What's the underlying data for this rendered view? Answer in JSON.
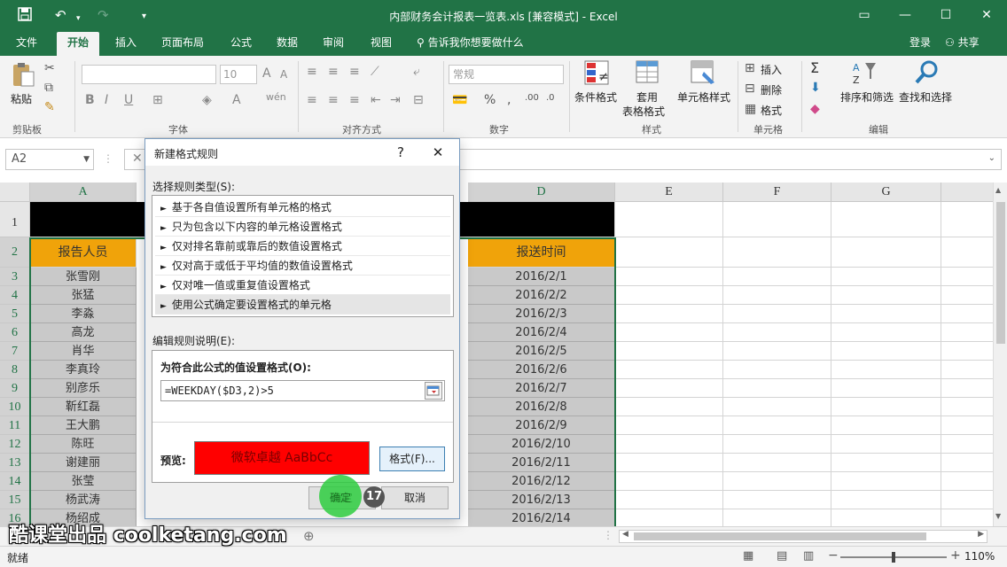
{
  "window": {
    "title": "内部财务会计报表一览表.xls  [兼容模式] - Excel",
    "buttons": [
      "restore-ribbon",
      "minimize",
      "maximize",
      "close"
    ]
  },
  "tabs": {
    "file": "文件",
    "home": "开始",
    "insert": "插入",
    "page_layout": "页面布局",
    "formulas": "公式",
    "data": "数据",
    "review": "审阅",
    "view": "视图",
    "tell_me": "告诉我你想要做什么",
    "login": "登录",
    "share": "共享"
  },
  "ribbon": {
    "clipboard": {
      "paste": "粘贴",
      "group": "剪贴板"
    },
    "font": {
      "size": "10",
      "group": "字体"
    },
    "alignment": {
      "group": "对齐方式"
    },
    "number": {
      "format": "常规",
      "group": "数字"
    },
    "styles": {
      "conditional": "条件格式",
      "table_format_1": "套用",
      "table_format_2": "表格格式",
      "cell_styles": "单元格样式",
      "group": "样式"
    },
    "cells": {
      "insert": "插入",
      "delete": "删除",
      "format": "格式",
      "group": "单元格"
    },
    "editing": {
      "sort_filter": "排序和筛选",
      "find_select": "查找和选择",
      "group": "编辑"
    }
  },
  "formula_bar": {
    "name_box": "A2"
  },
  "grid": {
    "columns": [
      "A",
      "D",
      "E",
      "F",
      "G"
    ],
    "row_numbers": [
      "1",
      "2",
      "3",
      "4",
      "5",
      "6",
      "7",
      "8",
      "9",
      "10",
      "11",
      "12",
      "13",
      "14",
      "15",
      "16"
    ],
    "header_a": "报告人员",
    "header_d": "报送时间",
    "names": [
      "张雪刚",
      "张猛",
      "李淼",
      "高龙",
      "肖华",
      "李真玲",
      "别彦乐",
      "靳红磊",
      "王大鹏",
      "陈旺",
      "谢建丽",
      "张莹",
      "杨武涛",
      "杨绍成"
    ],
    "dates": [
      "2016/2/1",
      "2016/2/2",
      "2016/2/3",
      "2016/2/4",
      "2016/2/5",
      "2016/2/6",
      "2016/2/7",
      "2016/2/8",
      "2016/2/9",
      "2016/2/10",
      "2016/2/11",
      "2016/2/12",
      "2016/2/13",
      "2016/2/14"
    ]
  },
  "status": {
    "ready": "就绪",
    "zoom": "110%"
  },
  "dialog": {
    "title": "新建格式规则",
    "help": "?",
    "close": "✕",
    "rule_type_label": "选择规则类型(S):",
    "rule_types": [
      "基于各自值设置所有单元格的格式",
      "只为包含以下内容的单元格设置格式",
      "仅对排名靠前或靠后的数值设置格式",
      "仅对高于或低于平均值的数值设置格式",
      "仅对唯一值或重复值设置格式",
      "使用公式确定要设置格式的单元格"
    ],
    "selected_rule_index": 5,
    "edit_desc_label": "编辑规则说明(E):",
    "formula_label": "为符合此公式的值设置格式(O):",
    "formula_value": "=WEEKDAY($D3,2)>5",
    "preview_label": "预览:",
    "preview_text": "微软卓越  AaBbCc",
    "preview_color": "#ff0000",
    "format_button": "格式(F)...",
    "ok_button": "确定",
    "cancel_button": "取消"
  },
  "tutorial": {
    "step": "17"
  },
  "watermark": "酷课堂出品 coolketang.com",
  "colors": {
    "excel_green": "#217346",
    "header_orange": "#f0a30a",
    "cell_gray": "#c9c9c9"
  }
}
